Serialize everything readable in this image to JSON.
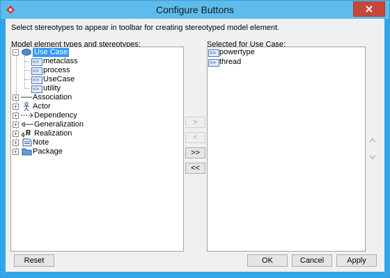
{
  "window": {
    "title": "Configure Buttons"
  },
  "instruction": "Select stereotypes to appear in toolbar for creating stereotyped model element.",
  "left_panel": {
    "label": "Model element types and stereotypes:",
    "tree": [
      {
        "label": "Use Case",
        "expanded": true,
        "selected": true,
        "children": [
          "metaclass",
          "process",
          "UseCase",
          "utility"
        ]
      },
      {
        "label": "Association"
      },
      {
        "label": "Actor"
      },
      {
        "label": "Dependency"
      },
      {
        "label": "Generalization"
      },
      {
        "label": "Realization"
      },
      {
        "label": "Note"
      },
      {
        "label": "Package"
      }
    ]
  },
  "right_panel": {
    "label": "Selected for Use Case:",
    "items": [
      "powertype",
      "thread"
    ]
  },
  "transfer_buttons": {
    "add": ">",
    "remove": "<",
    "add_all": ">>",
    "remove_all": "<<"
  },
  "footer": {
    "reset": "Reset",
    "ok": "OK",
    "cancel": "Cancel",
    "apply": "Apply"
  },
  "colors": {
    "titlebar": "#5ebcec",
    "close": "#c7473b",
    "selection": "#3399ff"
  }
}
